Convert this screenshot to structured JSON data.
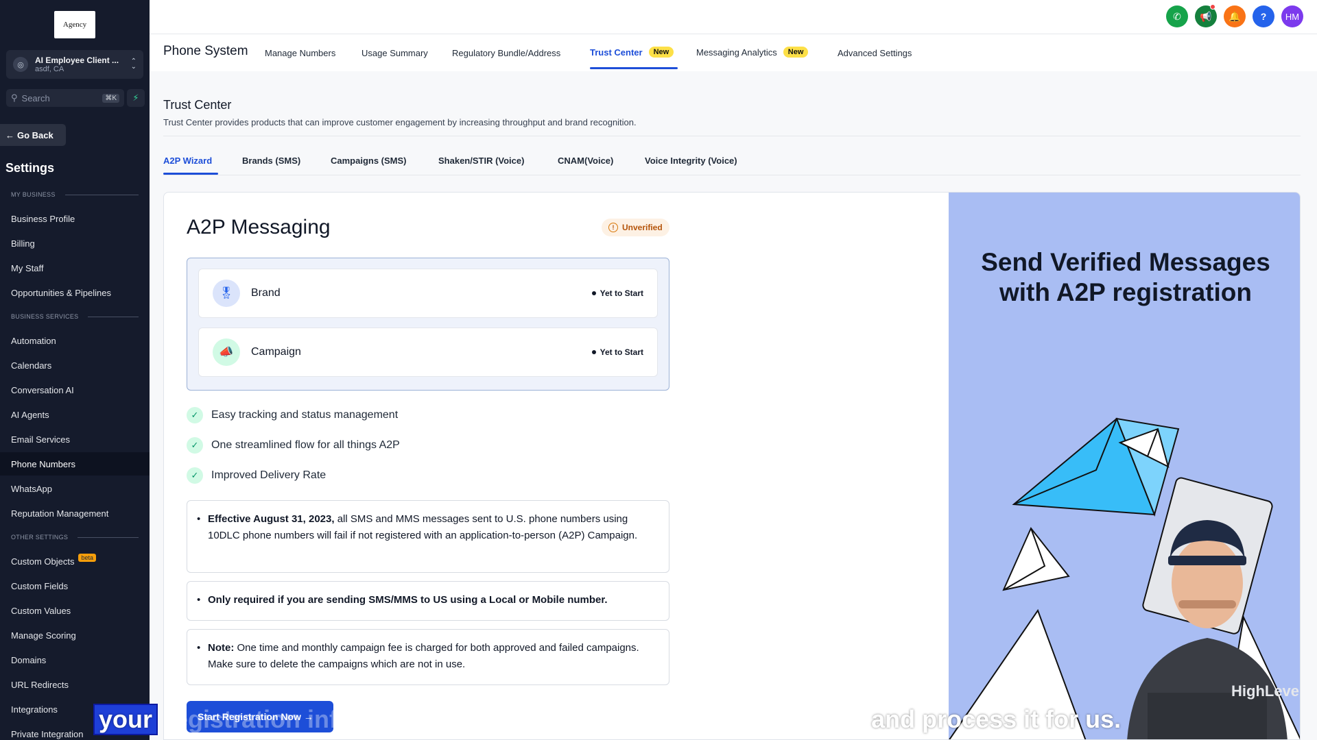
{
  "sidebar": {
    "logo_text": "Agency",
    "account": {
      "name": "AI Employee Client ...",
      "location": "asdf, CA"
    },
    "search": {
      "placeholder": "Search",
      "shortcut": "⌘K"
    },
    "go_back": "Go Back",
    "title": "Settings",
    "sections": {
      "my_business": "MY BUSINESS",
      "business_services": "BUSINESS SERVICES",
      "other_settings": "OTHER SETTINGS"
    },
    "items": {
      "business_profile": "Business Profile",
      "billing": "Billing",
      "my_staff": "My Staff",
      "opportunities": "Opportunities & Pipelines",
      "automation": "Automation",
      "calendars": "Calendars",
      "conversation_ai": "Conversation AI",
      "ai_agents": "AI Agents",
      "email_services": "Email Services",
      "phone_numbers": "Phone Numbers",
      "whatsapp": "WhatsApp",
      "reputation": "Reputation Management",
      "custom_objects": "Custom Objects",
      "custom_objects_badge": "beta",
      "custom_fields": "Custom Fields",
      "custom_values": "Custom Values",
      "manage_scoring": "Manage Scoring",
      "domains": "Domains",
      "url_redirects": "URL Redirects",
      "integrations": "Integrations",
      "private_integrations": "Private Integration"
    },
    "active_item": "Phone Numbers"
  },
  "topbar": {
    "avatar_initials": "HM",
    "help_label": "?",
    "colors": {
      "phone": "#16a34a",
      "megaphone": "#15803d",
      "bell": "#f97316",
      "help": "#2563eb",
      "avatar": "#7c3aed"
    }
  },
  "subheader": {
    "title": "Phone System",
    "tabs": {
      "manage_numbers": "Manage Numbers",
      "usage_summary": "Usage Summary",
      "regulatory": "Regulatory Bundle/Address",
      "trust_center": "Trust Center",
      "messaging_analytics": "Messaging Analytics",
      "advanced_settings": "Advanced Settings"
    },
    "new_badge": "New",
    "active_tab": "Trust Center"
  },
  "trust_center": {
    "title": "Trust Center",
    "description": "Trust Center provides products that can improve customer engagement by increasing throughput and brand recognition.",
    "tabs": {
      "a2p_wizard": "A2P Wizard",
      "brands": "Brands (SMS)",
      "campaigns": "Campaigns (SMS)",
      "shaken": "Shaken/STIR (Voice)",
      "cnam": "CNAM(Voice)",
      "voice_integrity": "Voice Integrity (Voice)"
    },
    "active_tab": "A2P Wizard"
  },
  "a2p": {
    "title": "A2P Messaging",
    "status_badge": "Unverified",
    "steps": {
      "brand": {
        "label": "Brand",
        "status": "Yet to Start"
      },
      "campaign": {
        "label": "Campaign",
        "status": "Yet to Start"
      }
    },
    "features": {
      "f1": "Easy tracking and status management",
      "f2": "One streamlined flow for all things A2P",
      "f3": "Improved Delivery Rate"
    },
    "notices": {
      "n1_bold": "Effective August 31, 2023,",
      "n1_text": " all SMS and MMS messages sent to U.S. phone numbers using 10DLC phone numbers will fail if not registered with an application-to-person (A2P) Campaign.",
      "n2_bold": "Only required if you are sending SMS/MMS to US using a Local or Mobile number.",
      "n3_bold": "Note:",
      "n3_text": " One time and monthly campaign fee is charged for both approved and failed campaigns. Make sure to delete the campaigns which are not in use."
    },
    "start_button": "Start Registration Now →"
  },
  "promo": {
    "title": "Send Verified Messages with A2P registration",
    "presenter_logo": "HighLevel"
  },
  "caption": {
    "highlighted": "your",
    "dim": "registration information and then HighLevel will submit that",
    "rest": "and process it for us."
  }
}
